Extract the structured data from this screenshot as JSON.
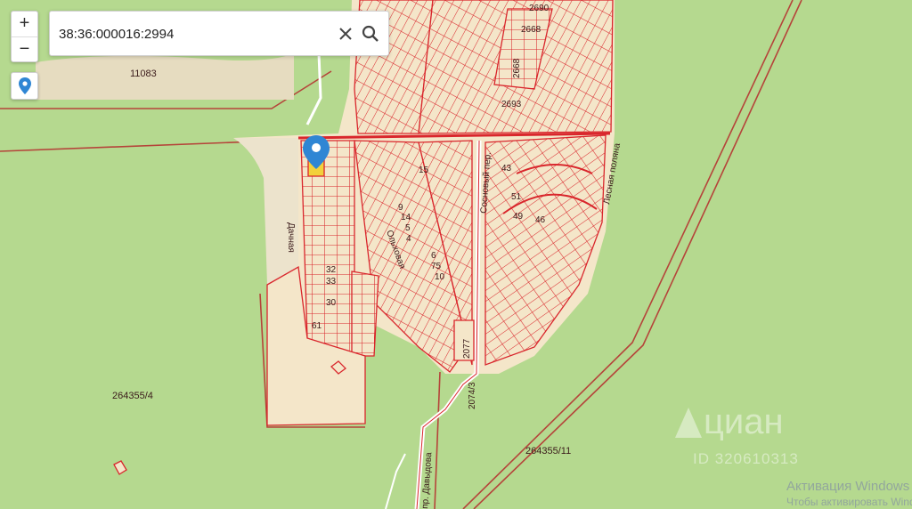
{
  "search": {
    "value": "38:36:000016:2994",
    "clear_icon": "close-icon",
    "search_icon": "search-icon"
  },
  "zoom": {
    "in_label": "+",
    "out_label": "−"
  },
  "locate": {
    "icon": "map-marker-icon"
  },
  "map": {
    "colors": {
      "forest": "#b5d98f",
      "settlement": "#f4e6c9",
      "parcel_border": "#d9262c",
      "road": "#ffffff"
    },
    "parcel_labels": [
      "11083",
      "264355/4",
      "264355/11",
      "2690",
      "2668",
      "2668",
      "2693",
      "2077",
      "2074/3",
      "32",
      "33",
      "30",
      "61",
      "15",
      "9",
      "14",
      "5",
      "4",
      "6",
      "75",
      "10",
      "43",
      "51",
      "49",
      "46"
    ],
    "street_labels": [
      "Сосновый пер.",
      "Лесная поляна",
      "Ольховая",
      "Дачная",
      "пр. Давыдова"
    ]
  },
  "watermark": {
    "brand": "циан",
    "id": "ID 320610313"
  },
  "activation": {
    "title": "Активация Windows",
    "subtitle": "Чтобы активировать Windows, перейдите в раздел «Параметры»"
  }
}
